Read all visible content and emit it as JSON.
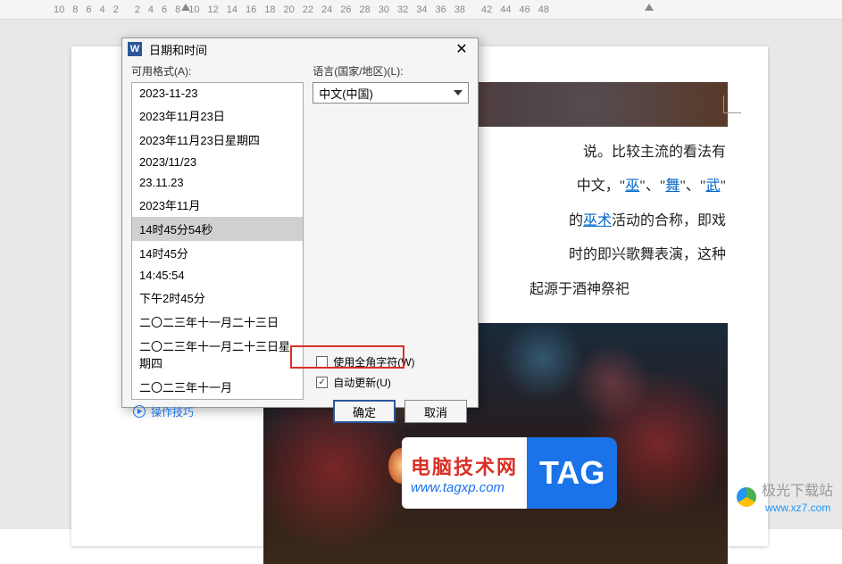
{
  "ruler": {
    "ticks": [
      "10",
      "8",
      "6",
      "4",
      "2",
      "",
      "2",
      "4",
      "6",
      "8",
      "10",
      "12",
      "14",
      "16",
      "18",
      "20",
      "22",
      "24",
      "26",
      "28",
      "30",
      "32",
      "34",
      "36",
      "38",
      "",
      "42",
      "44",
      "46",
      "48"
    ]
  },
  "dialog": {
    "title": "日期和时间",
    "formats_label": "可用格式(A):",
    "language_label": "语言(国家/地区)(L):",
    "language_value": "中文(中国)",
    "formats": [
      "2023-11-23",
      "2023年11月23日",
      "2023年11月23日星期四",
      "2023/11/23",
      "23.11.23",
      "2023年11月",
      "14时45分54秒",
      "14时45分",
      "14:45:54",
      "下午2时45分",
      "二〇二三年十一月二十三日",
      "二〇二三年十一月二十三日星期四",
      "二〇二三年十一月"
    ],
    "selected_index": 6,
    "fullwidth_label": "使用全角字符(W)",
    "fullwidth_checked": false,
    "autoupdate_label": "自动更新(U)",
    "autoupdate_checked": true,
    "tips_label": "操作技巧",
    "ok_label": "确定",
    "cancel_label": "取消"
  },
  "document": {
    "line1_suffix": "说。比较主流的看法有",
    "line2_prefix": "中文，\"",
    "link_wu1": "巫",
    "line2_mid1": "\"、\"",
    "link_wu2": "舞",
    "line2_mid2": "\"、\"",
    "link_wu3": "武",
    "line2_suffix": "\"",
    "line3_prefix": "的",
    "link_wushu": "巫术",
    "line3_suffix": "活动的合称，即戏",
    "line4": "时的即兴歌舞表演，这种",
    "line5": "起源于酒神祭祀"
  },
  "overlay": {
    "site_cn": "电脑技术网",
    "site_url": "www.tagxp.com",
    "tag": "TAG"
  },
  "watermark": {
    "text": "极光下载站",
    "url": "www.xz7.com"
  }
}
